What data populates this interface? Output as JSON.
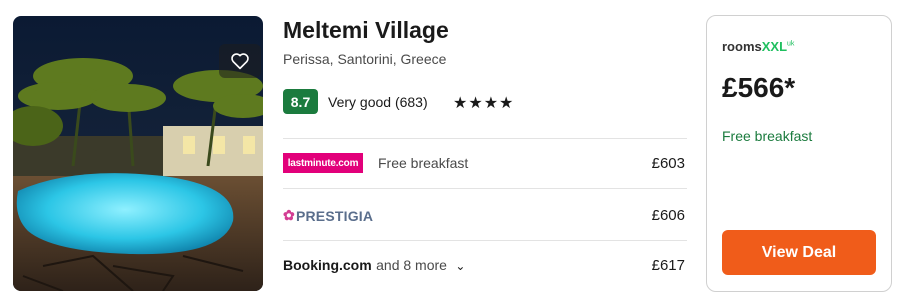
{
  "hotel": {
    "name": "Meltemi Village",
    "location": "Perissa, Santorini, Greece",
    "rating_score": "8.7",
    "rating_label": "Very good (683)",
    "stars": "★★★★",
    "star_count": 4,
    "photo_alt": "Hotel pool at night with palm trees",
    "favorite_icon": "heart-outline-icon"
  },
  "offers": [
    {
      "provider": "lastminute.com",
      "note": "Free breakfast",
      "price": "£603"
    },
    {
      "provider": "PRESTIGIA",
      "note": "",
      "price": "£606"
    },
    {
      "provider": "Booking.com",
      "more": "and 8 more",
      "price": "£617"
    }
  ],
  "deal": {
    "provider_main": "rooms",
    "provider_accent": "XXL",
    "provider_suffix": "uk",
    "price": "£566*",
    "note": "Free breakfast",
    "button_label": "View Deal"
  },
  "colors": {
    "rating_badge": "#1b7b3e",
    "cta": "#f05c1a",
    "lastminute": "#e2007a",
    "rooms_accent": "#1fbf5f",
    "free_breakfast": "#1b7b3e"
  }
}
